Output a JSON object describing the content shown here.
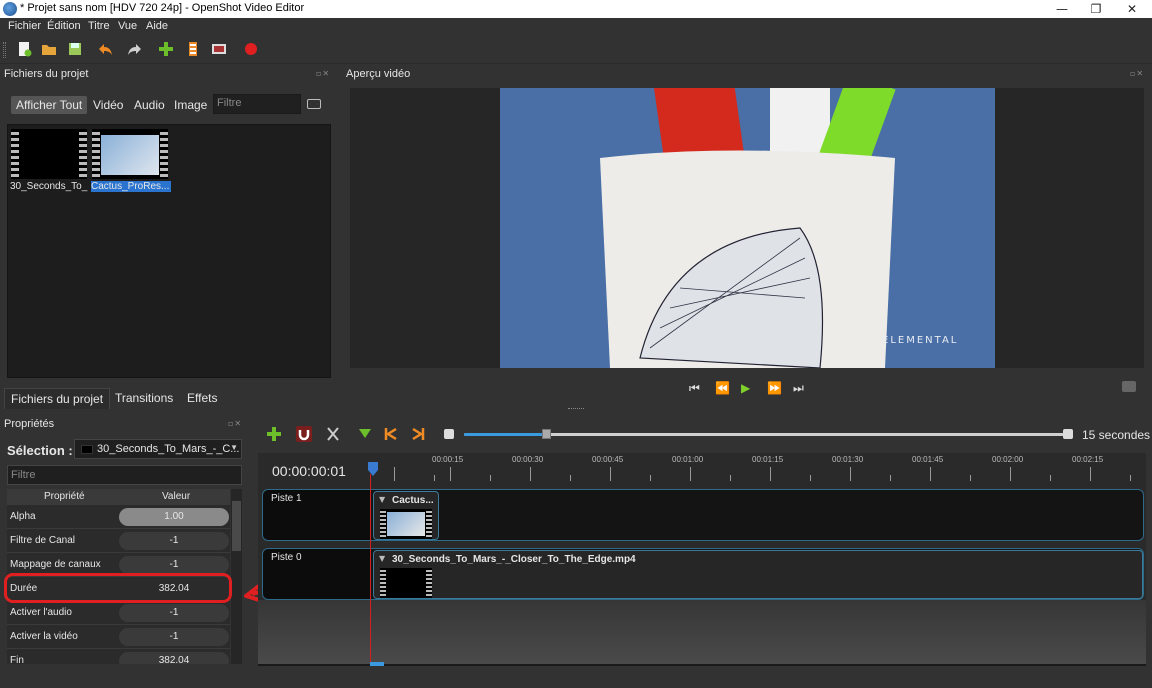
{
  "window": {
    "title": "* Projet sans nom [HDV 720 24p] - OpenShot Video Editor",
    "minimize": "—",
    "maximize": "❐",
    "close": "✕"
  },
  "menu": [
    "Fichier",
    "Édition",
    "Titre",
    "Vue",
    "Aide"
  ],
  "toolbar": {
    "icons": [
      "new-project-icon",
      "open-project-icon",
      "save-project-icon",
      "undo-icon",
      "redo-icon",
      "import-files-icon",
      "choose-profile-icon",
      "fullscreen-icon",
      "export-video-icon"
    ]
  },
  "project_files": {
    "title": "Fichiers du projet",
    "filters": [
      "Afficher Tout",
      "Vidéo",
      "Audio",
      "Image"
    ],
    "filter_placeholder": "Filtre",
    "files": [
      {
        "label": "30_Seconds_To_..."
      },
      {
        "label": "Cactus_ProRes..."
      }
    ],
    "bottom_tabs": [
      "Fichiers du projet",
      "Transitions",
      "Effets"
    ]
  },
  "preview": {
    "title": "Aperçu vidéo",
    "watermark": "ELEMENTAL",
    "controls": [
      "⏮",
      "⏪",
      "▶",
      "⏩",
      "⏭"
    ]
  },
  "properties": {
    "title": "Propriétés",
    "selection_label": "Sélection :",
    "selection_value": "30_Seconds_To_Mars_-_C...",
    "filter_placeholder": "Filtre",
    "col_property": "Propriété",
    "col_value": "Valeur",
    "rows": [
      {
        "name": "Alpha",
        "value": "1.00"
      },
      {
        "name": "Filtre de Canal",
        "value": "-1"
      },
      {
        "name": "Mappage de canaux",
        "value": "-1"
      },
      {
        "name": "Durée",
        "value": "382.04"
      },
      {
        "name": "Activer l'audio",
        "value": "-1"
      },
      {
        "name": "Activer la vidéo",
        "value": "-1"
      },
      {
        "name": "Fin",
        "value": "382.04"
      }
    ]
  },
  "timeline": {
    "zoom_label": "15 secondes",
    "timecode": "00:00:00:01",
    "ticks": [
      "00:00:15",
      "00:00:30",
      "00:00:45",
      "00:01:00",
      "00:01:15",
      "00:01:30",
      "00:01:45",
      "00:02:00",
      "00:02:15"
    ],
    "tracks": [
      {
        "name": "Piste 1",
        "clip": "Cactus..."
      },
      {
        "name": "Piste 0",
        "clip": "30_Seconds_To_Mars_-_Closer_To_The_Edge.mp4"
      }
    ]
  }
}
